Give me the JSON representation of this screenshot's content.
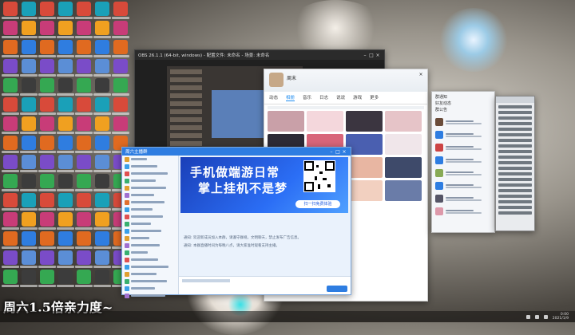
{
  "colors": {
    "chat_accent": "#2e7de1",
    "banner_blue": "#2b6ef5",
    "profile_accent": "#1e8cf0"
  },
  "stream_window": {
    "title": "OBS 26.1.1 (64-bit, windows) - 配置文件: 未命名 - 场景: 未命名"
  },
  "profile_window": {
    "name": "周末",
    "tabs": [
      "动态",
      "相册",
      "音乐",
      "日志",
      "说说",
      "游戏",
      "更多"
    ]
  },
  "chat_window": {
    "title": "周六主播群",
    "banner_line1": "手机做端游日常",
    "banner_line2": "掌上挂机不是梦",
    "banner_button": "扫一扫免费体验",
    "messages": [
      "通知: 欢迎新成员加入本群，请遵守群规，文明聊天，禁止发布广告信息。",
      "通知: 本群直播时间为每晚八点，请大家准时观看支持主播。"
    ]
  },
  "contacts_panel": {
    "header": [
      "群通知",
      "好友动态",
      "群公告"
    ]
  },
  "taskbar": {
    "time": "0:00",
    "date": "2021/1/9"
  },
  "promo_text": "周六1.5倍亲力度~"
}
